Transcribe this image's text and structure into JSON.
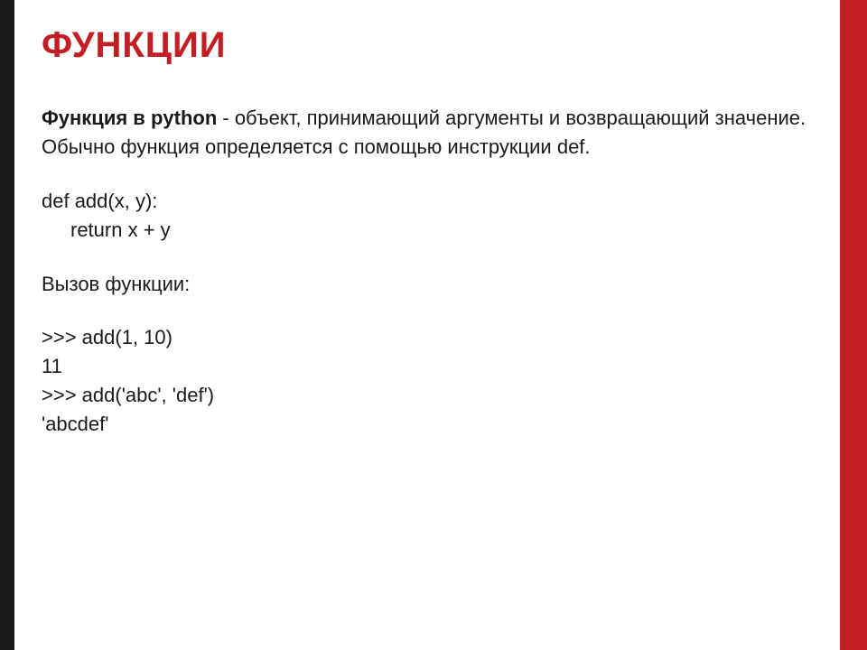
{
  "slide": {
    "title": "Функции",
    "intro_bold": "Функция в python",
    "intro_rest": " - объект, принимающий аргументы и возвращающий значение.",
    "intro_line2": "Обычно функция определяется с помощью инструкции def.",
    "code_def": "def add(x, y):",
    "code_return": "return x + y",
    "call_label": "Вызов функции:",
    "repl_line1": ">>> add(1, 10)",
    "repl_out1": "11",
    "repl_line2": ">>> add('abc', 'def')",
    "repl_out2": "'abcdef'"
  }
}
